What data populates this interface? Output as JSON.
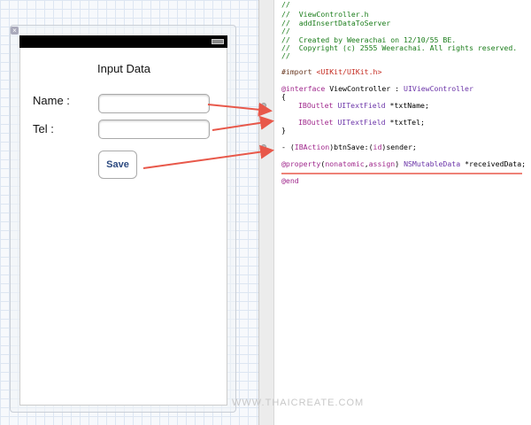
{
  "ui": {
    "title": "Input Data",
    "name_label": "Name :",
    "tel_label": "Tel :",
    "save_label": "Save",
    "name_value": "",
    "tel_value": ""
  },
  "code": {
    "l1": "//",
    "l2": "//  ViewController.h",
    "l3": "//  addInsertDataToServer",
    "l4": "//",
    "l5": "//  Created by Weerachai on 12/10/55 BE.",
    "l6": "//  Copyright (c) 2555 Weerachai. All rights reserved.",
    "l7": "//",
    "import_kw": "#import ",
    "import_file": "<UIKit/UIKit.h>",
    "interface_kw": "@interface",
    "interface_name": " ViewController : ",
    "interface_super": "UIViewController",
    "open_brace": "{",
    "outlet_kw": "IBOutlet",
    "uitextfield": "UITextField",
    "txtname": " *txtName;",
    "txttel": " *txtTel;",
    "close_brace": "}",
    "action_dash": "- (",
    "action_kw": "IBAction",
    "action_name": ")btnSave:(",
    "id_kw": "id",
    "action_rest": ")sender;",
    "property_kw": "@property",
    "paren_open": "(",
    "nonatomic": "nonatomic",
    "comma": ",",
    "assign": "assign",
    "paren_close": ") ",
    "nsmutable": "NSMutableData",
    "received": " *receivedData;",
    "end_kw": "@end"
  },
  "watermark": "WWW.THAICREATE.COM",
  "colors": {
    "arrow": "#e8584a",
    "comment": "#1b7d1b",
    "keyword": "#a0288c"
  }
}
